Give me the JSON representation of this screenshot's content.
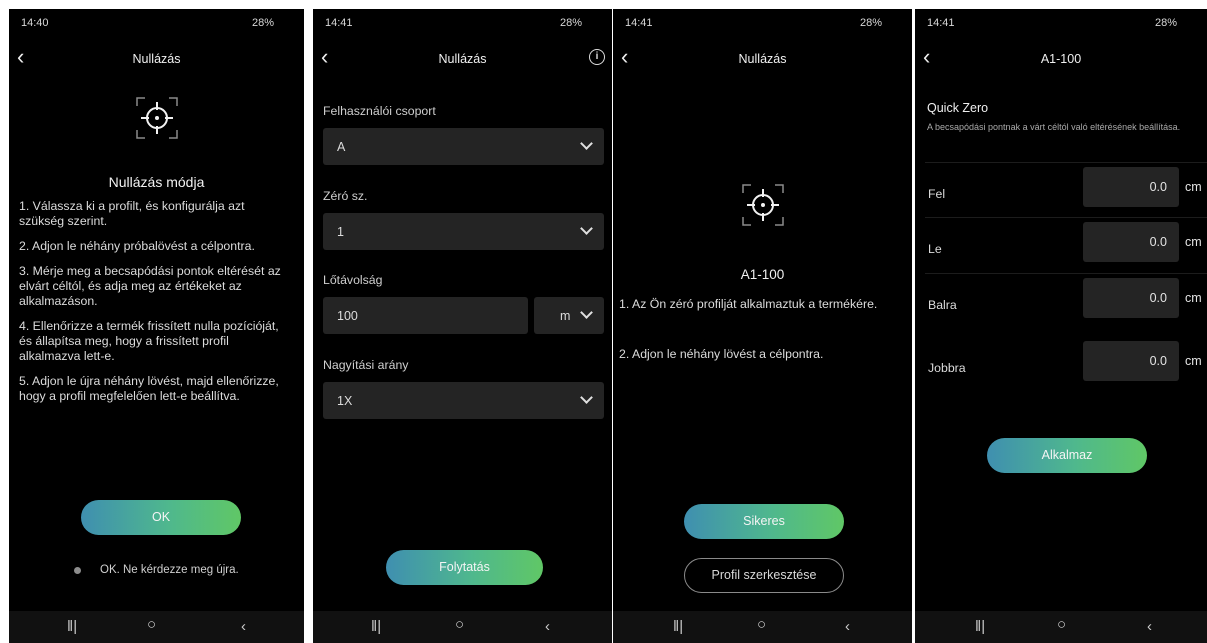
{
  "status_bars": [
    {
      "time": "14:40",
      "right": "28%"
    },
    {
      "time": "14:41",
      "right": "28%"
    },
    {
      "time": "14:41",
      "right": "28%"
    },
    {
      "time": "14:41",
      "right": "28%"
    }
  ],
  "screen1": {
    "title": "Nullázás",
    "mode_title": "Nullázás módja",
    "steps": [
      "1. Válassza ki a profilt, és konfigurálja azt szükség szerint.",
      "2. Adjon le néhány próbalövést a célpontra.",
      "3. Mérje meg a becsapódási pontok eltérését az elvárt céltól, és adja meg az értékeket az alkalmazáson.",
      "4. Ellenőrizze a termék frissített nulla pozícióját, és állapítsa meg, hogy a frissített profil alkalmazva lett-e.",
      "5. Adjon le újra néhány lövést, majd ellenőrizze, hogy a profil megfelelően lett-e beállítva."
    ],
    "ok_button": "OK",
    "dont_ask_label": "OK. Ne kérdezze meg újra."
  },
  "screen2": {
    "title": "Nullázás",
    "user_group_label": "Felhasználói csoport",
    "user_group_value": "A",
    "zero_no_label": "Zéró sz.",
    "zero_no_value": "1",
    "distance_label": "Lőtávolság",
    "distance_value": "100",
    "distance_unit": "m",
    "magnification_label": "Nagyítási arány",
    "magnification_value": "1X",
    "continue_button": "Folytatás"
  },
  "screen3": {
    "title": "Nullázás",
    "profile_name": "A1-100",
    "step1": "1. Az Ön zéró profilját alkalmaztuk a termékére.",
    "step2": "2. Adjon le néhány lövést a célpontra.",
    "success_button": "Sikeres",
    "edit_profile_button": "Profil szerkesztése"
  },
  "screen4": {
    "title": "A1-100",
    "quick_zero_title": "Quick Zero",
    "quick_zero_desc": "A becsapódási pontnak a várt céltól való eltérésének beállítása.",
    "rows": [
      {
        "label": "Fel",
        "value": "0.0",
        "unit": "cm"
      },
      {
        "label": "Le",
        "value": "0.0",
        "unit": "cm"
      },
      {
        "label": "Balra",
        "value": "0.0",
        "unit": "cm"
      },
      {
        "label": "Jobbra",
        "value": "0.0",
        "unit": "cm"
      }
    ],
    "apply_button": "Alkalmaz"
  },
  "icons": [
    "back-icon",
    "crosshair-icon",
    "info-icon",
    "chevron-down-icon",
    "recent-apps-icon",
    "home-icon",
    "nav-back-icon"
  ],
  "colors": {
    "button_gradient_start": "#3f8fb0",
    "button_gradient_end": "#60c766",
    "background": "#000000",
    "field": "#242424"
  }
}
